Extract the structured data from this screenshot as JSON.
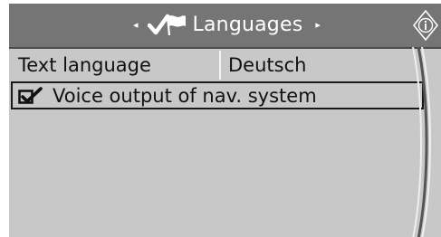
{
  "header": {
    "left_arrow": "◂",
    "right_arrow": "▸",
    "title": "Languages",
    "title_icon": "check-flag-icon",
    "info_icon": "info-diamond-icon"
  },
  "menu": {
    "items": [
      {
        "label": "Text language",
        "value": "Deutsch"
      },
      {
        "label": "Voice output of nav. system",
        "checked": true,
        "icon": "checkbox-checked-icon"
      }
    ]
  },
  "colors": {
    "header_bg": "#757575",
    "panel_bg": "#c8c8c8",
    "text": "#111111",
    "header_text": "#ffffff"
  }
}
